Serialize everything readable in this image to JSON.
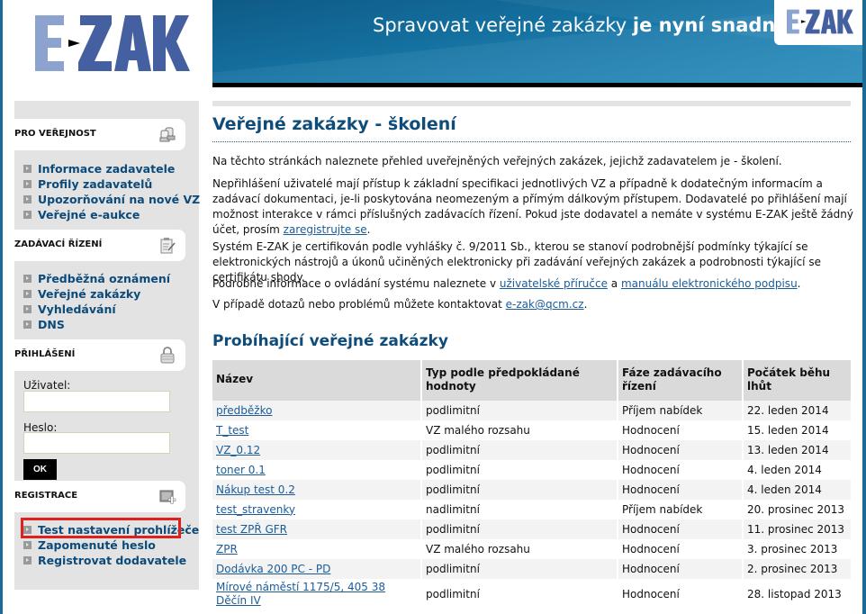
{
  "header": {
    "logo_text": "E-ZAK",
    "slogan_regular": "Spravovat veřejné zakázky ",
    "slogan_bold": "je nyní snadné",
    "banner_logo_text": "E-ZAK"
  },
  "sidebar": {
    "sections": [
      {
        "title": "PRO VEŘEJNOST",
        "icon": "users-icon",
        "items": [
          {
            "label": "Informace zadavatele"
          },
          {
            "label": "Profily zadavatelů"
          },
          {
            "label": "Upozorňování na nové VZ"
          },
          {
            "label": "Veřejné e-aukce"
          }
        ]
      },
      {
        "title": "ZADÁVACÍ ŘÍZENÍ",
        "icon": "clipboard-edit-icon",
        "items": [
          {
            "label": "Předběžná oznámení"
          },
          {
            "label": "Veřejné zakázky"
          },
          {
            "label": "Vyhledávání"
          },
          {
            "label": "DNS"
          }
        ]
      },
      {
        "title": "PŘIHLÁŠENÍ",
        "icon": "lock-icon"
      },
      {
        "title": "REGISTRACE",
        "icon": "window-add-icon",
        "items": [
          {
            "label": "Test nastavení prohlížeče"
          },
          {
            "label": "Zapomenuté heslo"
          },
          {
            "label": "Registrovat dodavatele"
          }
        ]
      }
    ],
    "login": {
      "user_label": "Uživatel:",
      "user_value": "",
      "password_label": "Heslo:",
      "password_value": "",
      "ok_label": "OK"
    }
  },
  "main": {
    "title": "Veřejné zakázky - školení",
    "para1": "Na těchto stránkách naleznete přehled uveřejněných veřejných zakázek, jejichž zadavatelem je - školení.",
    "para2_text": "Nepřihlášení uživatelé mají přístup k základní specifikaci jednotlivých VZ a případně k dodatečným informacím a zadávací dokumentaci, je-li poskytována neomezeným a přímým dálkovým přístupem. Dodavatelé po přihlášení mají možnost interakce v rámci příslušných zadávacích řízení. Pokud jste dodavatel a nemáte v systému E-ZAK ještě žádný účet, prosím ",
    "para2_link": "zaregistrujte se",
    "para2_end": ".",
    "para3": "Systém E-ZAK je certifikován podle vyhlášky č. 9/2011 Sb., kterou se stanoví podrobnější podmínky týkající se elektronických nástrojů a úkonů učiněných elektronicky při zadávání veřejných zakázek a podrobnosti týkající se certifikátu shody.",
    "para4_text": "Podrobné informace o ovládání systému naleznete v ",
    "para4_link1": "uživatelské příručce",
    "para4_mid": " a ",
    "para4_link2": "manuálu elektronického podpisu",
    "para4_end": ".",
    "para5_text": "V případě dotazů nebo problémů můžete kontaktovat ",
    "para5_link": "e-zak@qcm.cz",
    "para5_end": ".",
    "section_title": "Probíhající veřejné zakázky",
    "table": {
      "headers": [
        "Název",
        "Typ podle předpokládané hodnoty",
        "Fáze zadávacího řízení",
        "Počátek běhu lhůt"
      ],
      "rows": [
        {
          "name": "předběžko",
          "type": "podlimitní",
          "phase": "Příjem nabídek",
          "start": "22. leden 2014"
        },
        {
          "name": "T_test",
          "type": "VZ malého rozsahu",
          "phase": "Hodnocení",
          "start": "15. leden 2014"
        },
        {
          "name": "VZ_0.12",
          "type": "podlimitní",
          "phase": "Hodnocení",
          "start": "13. leden 2014"
        },
        {
          "name": "toner 0.1",
          "type": "podlimitní",
          "phase": "Hodnocení",
          "start": "4. leden 2014"
        },
        {
          "name": "Nákup test 0.2",
          "type": "podlimitní",
          "phase": "Hodnocení",
          "start": "4. leden 2014"
        },
        {
          "name": "test_stravenky",
          "type": "nadlimitní",
          "phase": "Příjem nabídek",
          "start": "20. prosinec 2013"
        },
        {
          "name": "test ZPŘ GFR",
          "type": "podlimitní",
          "phase": "Hodnocení",
          "start": "11. prosinec 2013"
        },
        {
          "name": "ZPR",
          "type": "VZ malého rozsahu",
          "phase": "Hodnocení",
          "start": "3. prosinec 2013"
        },
        {
          "name": "Dodávka 200 PC - PD",
          "type": "podlimitní",
          "phase": "Hodnocení",
          "start": "2. prosinec 2013"
        },
        {
          "name": "Mírové náměstí 1175/5, 405 38 Děčín IV",
          "type": "podlimitní",
          "phase": "Hodnocení",
          "start": "28. listopad 2013"
        }
      ]
    }
  },
  "colors": {
    "brand_dark": "#3f5a9a",
    "brand_light": "#8ca3cf",
    "link": "#1a5c99",
    "heading": "#0f4c7a",
    "highlight": "#e0201c"
  }
}
